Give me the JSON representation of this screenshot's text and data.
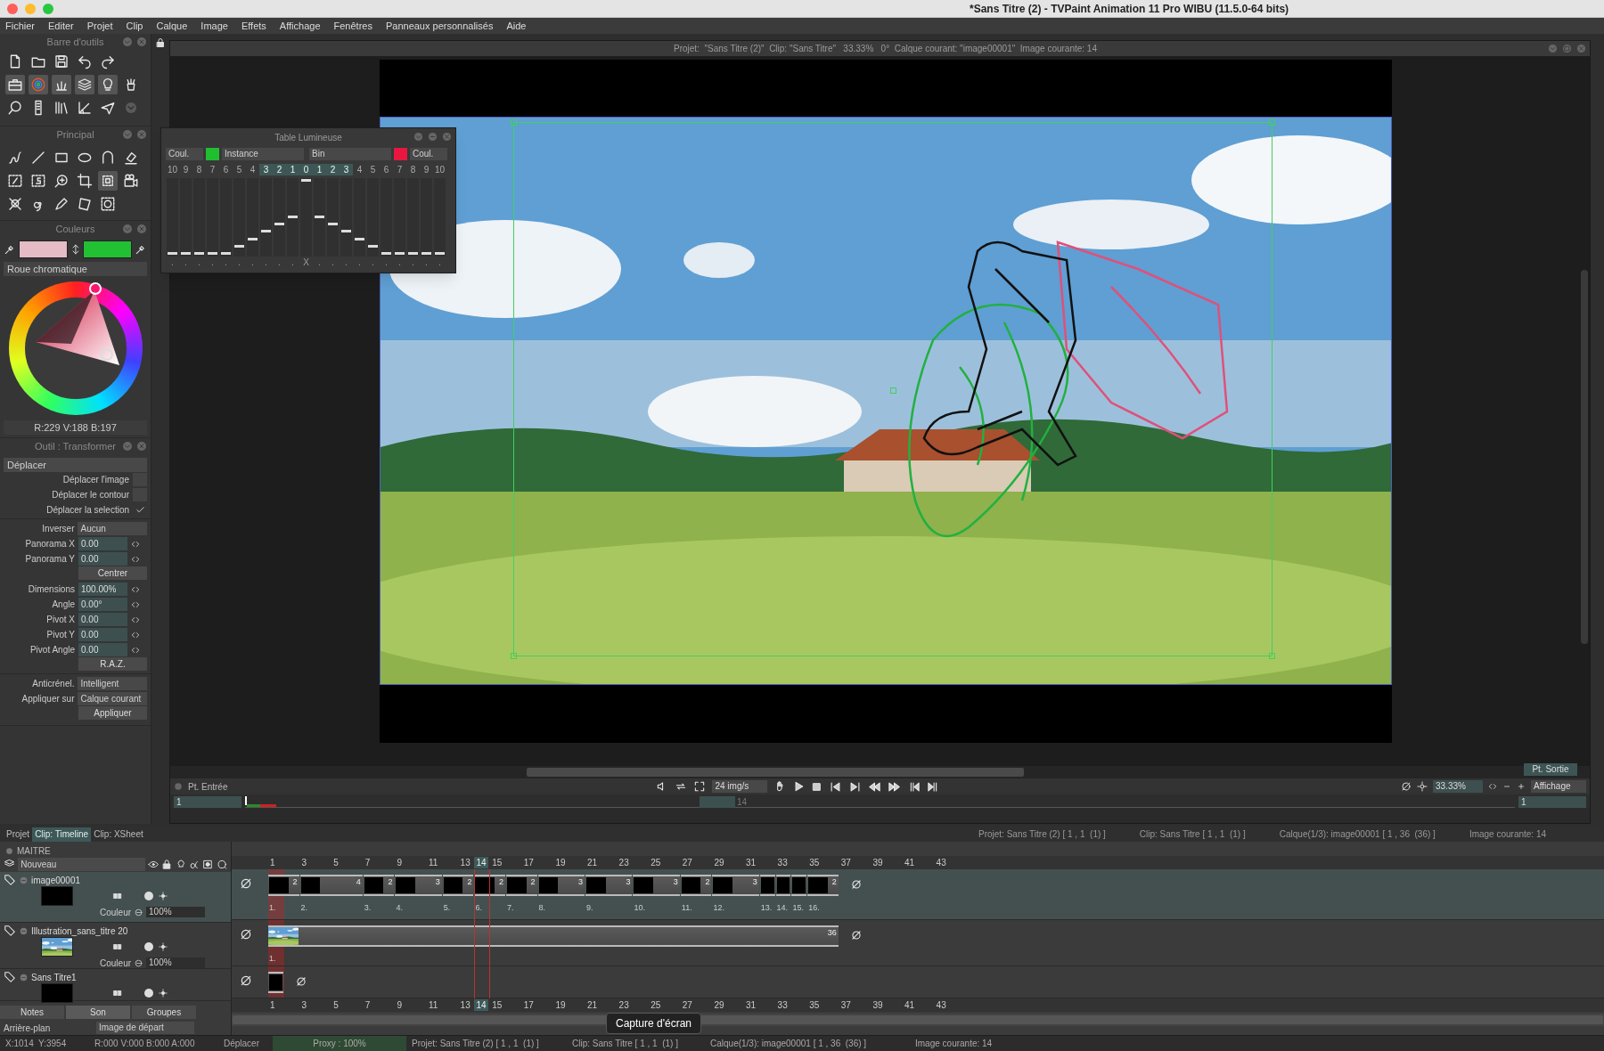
{
  "window": {
    "title": "*Sans Titre (2) - TVPaint Animation 11 Pro WIBU (11.5.0-64 bits)"
  },
  "menu": [
    "Fichier",
    "Editer",
    "Projet",
    "Clip",
    "Calque",
    "Image",
    "Effets",
    "Affichage",
    "Fenêtres",
    "Panneaux personnalisés",
    "Aide"
  ],
  "toolbar_panel": {
    "title": "Barre d'outils"
  },
  "main_panel": {
    "title": "Principal"
  },
  "colors_panel": {
    "title": "Couleurs",
    "swatches": [
      {
        "color": "#e5bcc5"
      },
      {
        "color": "#22c033"
      }
    ],
    "mode": "Roue chromatique",
    "readout": "R:229 V:188 B:197"
  },
  "transform_panel": {
    "title": "Outil : Transformer",
    "mode": "Déplacer",
    "options": [
      {
        "label": "Déplacer l'image",
        "checked": false
      },
      {
        "label": "Déplacer le contour",
        "checked": false
      },
      {
        "label": "Déplacer la selection",
        "checked": true
      }
    ],
    "inverse": {
      "label": "Inverser",
      "value": "Aucun"
    },
    "fields": [
      {
        "kind": "field",
        "label": "Panorama X",
        "value": "0.00"
      },
      {
        "kind": "field",
        "label": "Panorama Y",
        "value": "0.00"
      },
      {
        "kind": "button",
        "label": "Centrer"
      },
      {
        "kind": "field",
        "label": "Dimensions",
        "value": "100.00%"
      },
      {
        "kind": "field",
        "label": "Angle",
        "value": "0.00°"
      },
      {
        "kind": "field",
        "label": "Pivot X",
        "value": "0.00"
      },
      {
        "kind": "field",
        "label": "Pivot Y",
        "value": "0.00"
      },
      {
        "kind": "field",
        "label": "Pivot Angle",
        "value": "0.00"
      },
      {
        "kind": "button",
        "label": "R.A.Z."
      }
    ],
    "antialias": {
      "label": "Anticrénel.",
      "value": "Intelligent"
    },
    "apply_on": {
      "label": "Appliquer sur",
      "value": "Calque courant"
    },
    "apply_button": "Appliquer"
  },
  "light_table": {
    "title": "Table Lumineuse",
    "left": {
      "mode": "Coul.",
      "color": "#1fbf2f",
      "source": "Instance"
    },
    "right": {
      "source": "Bin",
      "color": "#e8173f",
      "mode": "Coul."
    },
    "columns": [
      {
        "label": "10",
        "level": 0,
        "active": false,
        "mark": "."
      },
      {
        "label": "9",
        "level": 0,
        "active": false,
        "mark": "."
      },
      {
        "label": "8",
        "level": 0,
        "active": false,
        "mark": "."
      },
      {
        "label": "7",
        "level": 0,
        "active": false,
        "mark": "."
      },
      {
        "label": "6",
        "level": 0,
        "active": false,
        "mark": "."
      },
      {
        "label": "5",
        "level": 0.1,
        "active": false,
        "mark": "."
      },
      {
        "label": "4",
        "level": 0.2,
        "active": false,
        "mark": "."
      },
      {
        "label": "3",
        "level": 0.3,
        "active": true,
        "mark": "."
      },
      {
        "label": "2",
        "level": 0.4,
        "active": true,
        "mark": "."
      },
      {
        "label": "1",
        "level": 0.5,
        "active": true,
        "mark": "."
      },
      {
        "label": "0",
        "level": 1,
        "active": true,
        "mark": "X"
      },
      {
        "label": "1",
        "level": 0.5,
        "active": true,
        "mark": "."
      },
      {
        "label": "2",
        "level": 0.4,
        "active": true,
        "mark": "."
      },
      {
        "label": "3",
        "level": 0.3,
        "active": true,
        "mark": "."
      },
      {
        "label": "4",
        "level": 0.2,
        "active": false,
        "mark": "."
      },
      {
        "label": "5",
        "level": 0.1,
        "active": false,
        "mark": "."
      },
      {
        "label": "6",
        "level": 0,
        "active": false,
        "mark": "."
      },
      {
        "label": "7",
        "level": 0,
        "active": false,
        "mark": "."
      },
      {
        "label": "8",
        "level": 0,
        "active": false,
        "mark": "."
      },
      {
        "label": "9",
        "level": 0,
        "active": false,
        "mark": "."
      },
      {
        "label": "10",
        "level": 0,
        "active": false,
        "mark": "."
      }
    ]
  },
  "canvas": {
    "header": "Projet:  \"Sans Titre (2)\"  Clip: \"Sans Titre\"   33.33%   0°  Calque courant: \"image00001\"  Image courante: 14",
    "in_label": "Pt. Entrée",
    "fps": "24 img/s",
    "zoom": "33.33%",
    "view": "Affichage",
    "out_label": "Pt. Sortie",
    "in_frame": "1",
    "out_frame": "1",
    "current_frame": "14"
  },
  "timeline": {
    "tabs": [
      {
        "label": "Projet",
        "selected": false
      },
      {
        "label": "Clip: Timeline",
        "selected": true
      },
      {
        "label": "Clip: XSheet",
        "selected": false
      }
    ],
    "info": [
      "Projet: Sans Titre (2) [ 1 , 1  (1) ]",
      "Clip: Sans Titre [ 1 , 1  (1) ]",
      "Calque(1/3): image00001 [ 1 , 36  (36) ]",
      "Image courante: 14"
    ],
    "master": "MAITRE",
    "new_layer": "Nouveau",
    "ruler_top": [
      {
        "label": "1",
        "current": false
      },
      {
        "label": "3",
        "current": false
      },
      {
        "label": "5",
        "current": false
      },
      {
        "label": "7",
        "current": false
      },
      {
        "label": "9",
        "current": false
      },
      {
        "label": "11",
        "current": false
      },
      {
        "label": "13",
        "current": false
      },
      {
        "label": "14",
        "current": true
      },
      {
        "label": "15",
        "current": false
      },
      {
        "label": "17",
        "current": false
      },
      {
        "label": "19",
        "current": false
      },
      {
        "label": "21",
        "current": false
      },
      {
        "label": "23",
        "current": false
      },
      {
        "label": "25",
        "current": false
      },
      {
        "label": "27",
        "current": false
      },
      {
        "label": "29",
        "current": false
      },
      {
        "label": "31",
        "current": false
      },
      {
        "label": "33",
        "current": false
      },
      {
        "label": "35",
        "current": false
      },
      {
        "label": "37",
        "current": false
      },
      {
        "label": "39",
        "current": false
      },
      {
        "label": "41",
        "current": false
      },
      {
        "label": "43",
        "current": false
      }
    ],
    "layers": [
      {
        "name": "image00001",
        "selected": true,
        "kind": "drawing",
        "blend": "Couleur",
        "opacity": "100%",
        "instances": [
          {
            "label": "1.",
            "duration": "2",
            "selected": true
          },
          {
            "label": "2.",
            "duration": "4",
            "selected": false
          },
          {
            "label": "3.",
            "duration": "2",
            "selected": false
          },
          {
            "label": "4.",
            "duration": "3",
            "selected": false
          },
          {
            "label": "5.",
            "duration": "2",
            "selected": false
          },
          {
            "label": "6.",
            "duration": "2",
            "selected": false
          },
          {
            "label": "7.",
            "duration": "2",
            "selected": false
          },
          {
            "label": "8.",
            "duration": "3",
            "selected": false
          },
          {
            "label": "9.",
            "duration": "3",
            "selected": false
          },
          {
            "label": "10.",
            "duration": "3",
            "selected": false
          },
          {
            "label": "11.",
            "duration": "2",
            "selected": false
          },
          {
            "label": "12.",
            "duration": "3",
            "selected": false
          },
          {
            "label": "13.",
            "selected": false
          },
          {
            "label": "14.",
            "selected": false
          },
          {
            "label": "15.",
            "selected": false
          },
          {
            "label": "16.",
            "duration": "2",
            "selected": false
          }
        ]
      },
      {
        "name": "Illustration_sans_titre 20",
        "selected": false,
        "kind": "picture",
        "blend": "Couleur",
        "opacity": "100%",
        "instances": [
          {
            "label": "1.",
            "duration": "36",
            "selected": true
          }
        ]
      },
      {
        "name": "Sans Titre1",
        "selected": false,
        "kind": "drawing",
        "instances": [
          {
            "selected": true
          }
        ]
      }
    ],
    "ruler_bottom": [
      {
        "label": "1",
        "current": false
      },
      {
        "label": "3",
        "current": false
      },
      {
        "label": "5",
        "current": false
      },
      {
        "label": "7",
        "current": false
      },
      {
        "label": "9",
        "current": false
      },
      {
        "label": "11",
        "current": false
      },
      {
        "label": "13",
        "current": false
      },
      {
        "label": "14",
        "current": true
      },
      {
        "label": "15",
        "current": false
      },
      {
        "label": "17",
        "current": false
      },
      {
        "label": "19",
        "current": false
      },
      {
        "label": "21",
        "current": false
      },
      {
        "label": "23",
        "current": false
      },
      {
        "label": "25",
        "current": false
      },
      {
        "label": "27",
        "current": false
      },
      {
        "label": "29",
        "current": false
      },
      {
        "label": "31",
        "current": false
      },
      {
        "label": "33",
        "current": false
      },
      {
        "label": "35",
        "current": false
      },
      {
        "label": "37",
        "current": false
      },
      {
        "label": "39",
        "current": false
      },
      {
        "label": "41",
        "current": false
      },
      {
        "label": "43",
        "current": false
      }
    ],
    "bottom_tabs": [
      {
        "label": "Notes",
        "selected": false
      },
      {
        "label": "Son",
        "selected": true
      },
      {
        "label": "Groupes",
        "selected": false
      }
    ],
    "background_label": "Arrière-plan",
    "start_image": "Image de départ"
  },
  "status_bar": [
    "X:1014  Y:3954",
    "R:000 V:000 B:000 A:000",
    "Déplacer",
    "Proxy : 100%",
    "Projet: Sans Titre (2) [ 1 , 1  (1) ]",
    "Clip: Sans Titre [ 1 , 1  (1) ]",
    "Calque(1/3): image00001 [ 1 , 36  (36) ]",
    "Image courante: 14"
  ],
  "tooltip": "Capture d'écran"
}
